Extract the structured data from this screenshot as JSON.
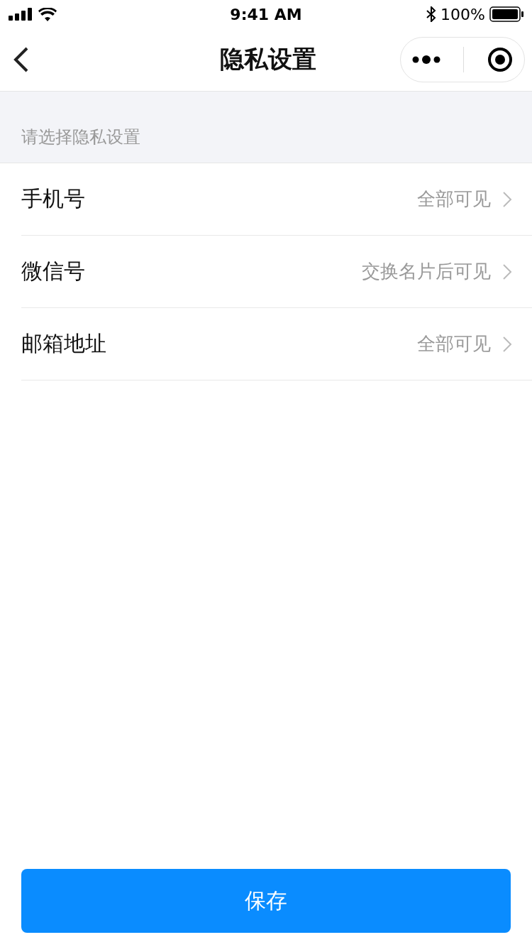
{
  "status_bar": {
    "time": "9:41 AM",
    "battery": "100%"
  },
  "nav": {
    "title": "隐私设置"
  },
  "section": {
    "label": "请选择隐私设置"
  },
  "rows": [
    {
      "label": "手机号",
      "value": "全部可见"
    },
    {
      "label": "微信号",
      "value": "交换名片后可见"
    },
    {
      "label": "邮箱地址",
      "value": "全部可见"
    }
  ],
  "save_button": "保存"
}
